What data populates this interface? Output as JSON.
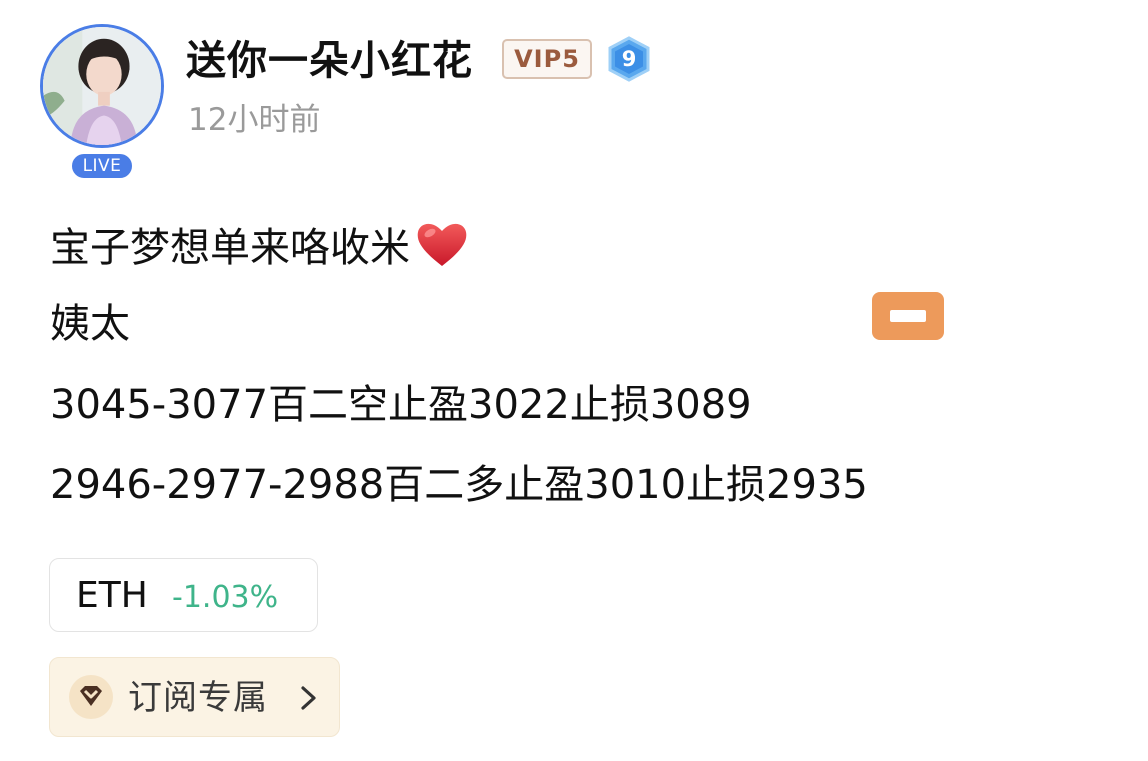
{
  "header": {
    "username": "送你一朵小红花",
    "vip_label": "VIP5",
    "level": "9",
    "timestamp": "12小时前",
    "live_label": "LIVE"
  },
  "content": {
    "line1": "宝子梦想单来咯收米",
    "line2": "姨太",
    "line3": "3045-3077百二空止盈3022止损3089",
    "line4": "2946-2977-2988百二多止盈3010止损2935"
  },
  "ticker": {
    "symbol": "ETH",
    "change": "-1.03%"
  },
  "subscribe": {
    "label": "订阅专属"
  },
  "colors": {
    "avatar_ring": "#4a7de6",
    "vip_text": "#9b5b3e",
    "change_positive_green": "#3fb48a",
    "sticker_orange": "#ed9a5b",
    "subscribe_bg": "#fbf3e4"
  },
  "icons": {
    "heart": "heart-icon",
    "level": "hexagon-level-icon",
    "subscribe": "diamond-icon",
    "chevron": "chevron-right-icon"
  }
}
